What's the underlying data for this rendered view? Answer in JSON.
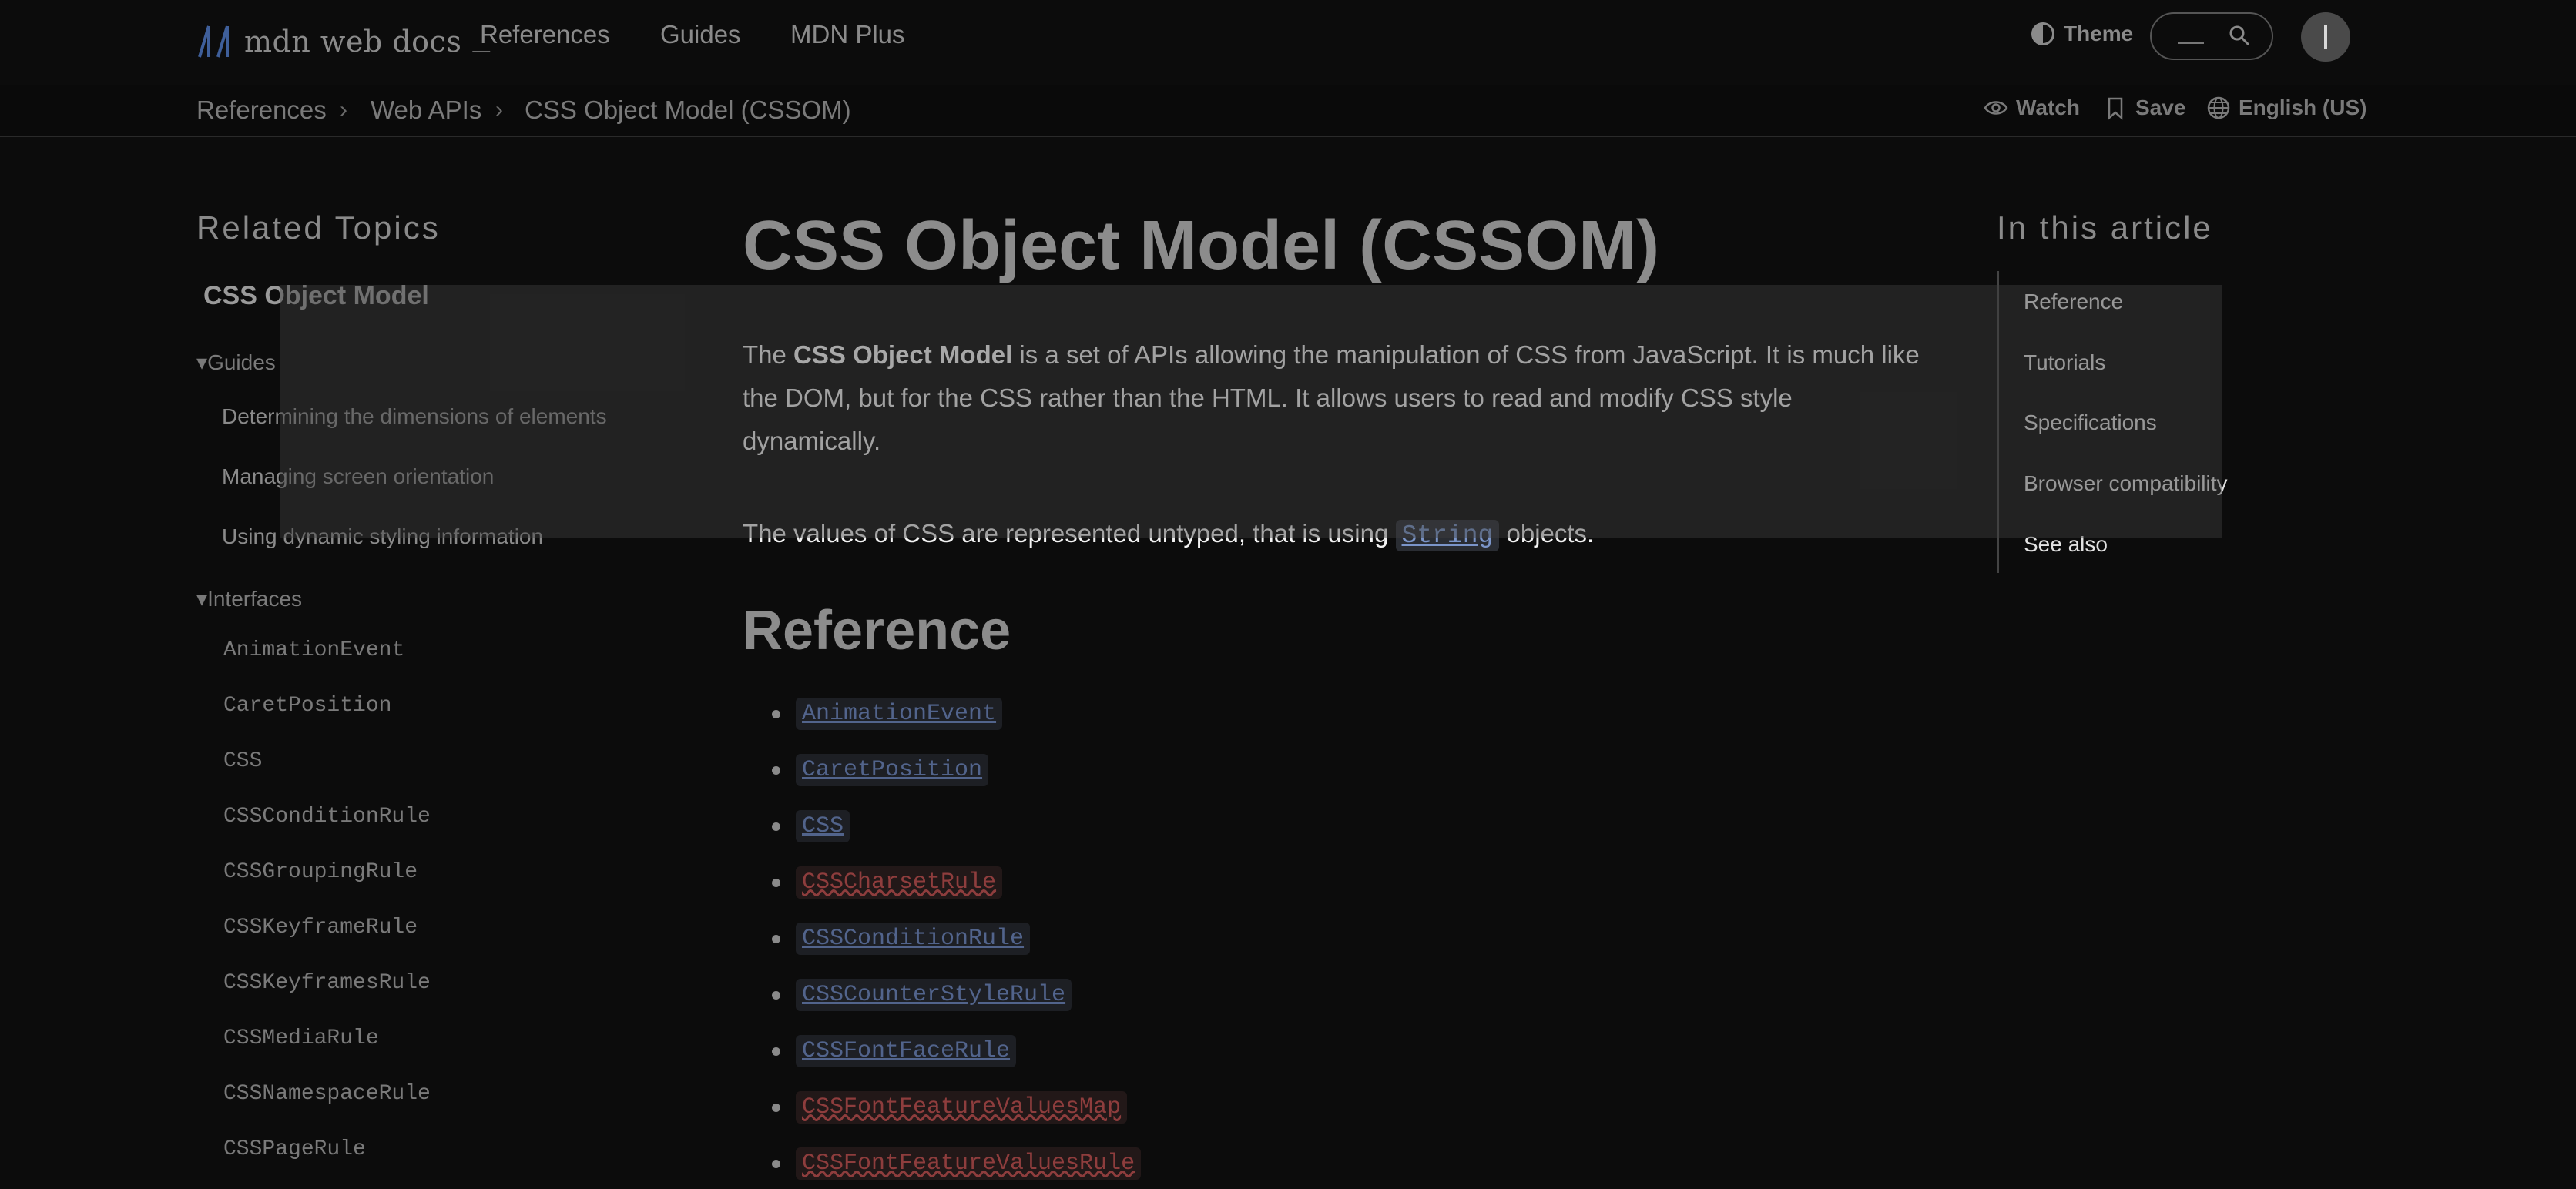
{
  "header": {
    "logo_text": "mdn web docs",
    "logo_cursor": "_",
    "nav": [
      "References",
      "Guides",
      "MDN Plus"
    ],
    "theme_label": "Theme"
  },
  "breadcrumb": {
    "items": [
      "References",
      "Web APIs",
      "CSS Object Model (CSSOM)"
    ],
    "actions": {
      "watch": "Watch",
      "save": "Save",
      "language": "English (US)"
    }
  },
  "sidebar": {
    "title": "Related Topics",
    "heading": "CSS Object Model",
    "groups": {
      "guides": {
        "label": "Guides",
        "items": [
          "Determining the dimensions of elements",
          "Managing screen orientation",
          "Using dynamic styling information"
        ]
      },
      "interfaces": {
        "label": "Interfaces",
        "items": [
          "AnimationEvent",
          "CaretPosition",
          "CSS",
          "CSSConditionRule",
          "CSSGroupingRule",
          "CSSKeyframeRule",
          "CSSKeyframesRule",
          "CSSMediaRule",
          "CSSNamespaceRule",
          "CSSPageRule"
        ]
      }
    }
  },
  "main": {
    "title": "CSS Object Model (CSSOM)",
    "intro": {
      "pre": "The ",
      "bold": "CSS Object Model",
      "post": " is a set of APIs allowing the manipulation of CSS from JavaScript. It is much like the DOM, but for the CSS rather than the HTML. It allows users to read and modify CSS style dynamically."
    },
    "values": {
      "pre": "The values of CSS are represented untyped, that is using ",
      "code": "String",
      "post": " objects."
    },
    "reference_heading": "Reference",
    "reference_items": [
      {
        "name": "AnimationEvent",
        "exists": true
      },
      {
        "name": "CaretPosition",
        "exists": true
      },
      {
        "name": "CSS",
        "exists": true
      },
      {
        "name": "CSSCharsetRule",
        "exists": false
      },
      {
        "name": "CSSConditionRule",
        "exists": true
      },
      {
        "name": "CSSCounterStyleRule",
        "exists": true
      },
      {
        "name": "CSSFontFaceRule",
        "exists": true
      },
      {
        "name": "CSSFontFeatureValuesMap",
        "exists": false
      },
      {
        "name": "CSSFontFeatureValuesRule",
        "exists": false
      }
    ]
  },
  "toc": {
    "title": "In this article",
    "items": [
      "Reference",
      "Tutorials",
      "Specifications",
      "Browser compatibility",
      "See also"
    ]
  },
  "colors": {
    "background": "#0c0c0c",
    "link": "#52648c",
    "broken_link": "#8e3d3d"
  }
}
